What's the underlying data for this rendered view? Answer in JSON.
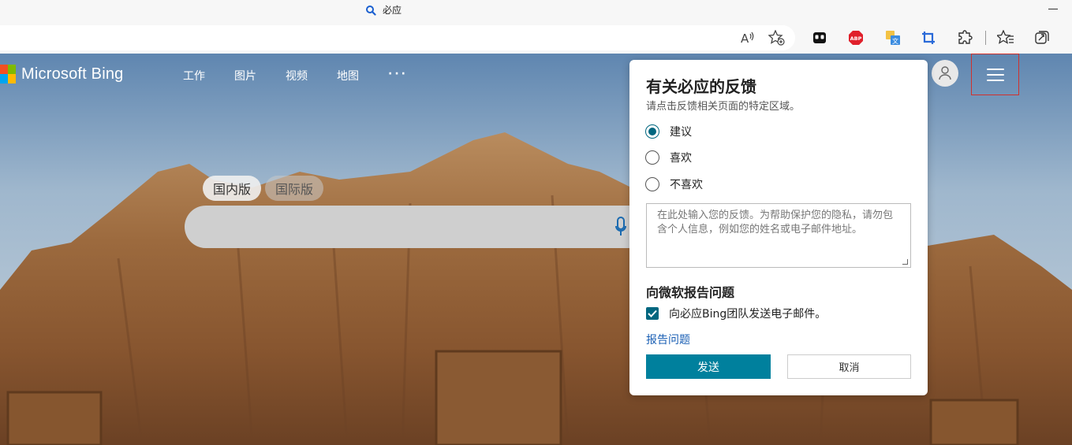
{
  "browser": {
    "tab_title": "必应",
    "toolbar_icons": [
      "read-aloud-icon",
      "add-favorite-icon",
      "extension-icon",
      "adblock-icon",
      "translate-icon",
      "crop-icon",
      "extensions-icon",
      "favorites-icon",
      "collections-icon"
    ]
  },
  "header": {
    "logo_text": "Microsoft Bing",
    "nav": [
      "工作",
      "图片",
      "视频",
      "地图"
    ],
    "more": "···"
  },
  "search": {
    "region_tabs": [
      "国内版",
      "国际版"
    ],
    "active_region": "国内版"
  },
  "feedback": {
    "title": "有关必应的反馈",
    "subtitle": "请点击反馈相关页面的特定区域。",
    "options": [
      {
        "label": "建议",
        "checked": true
      },
      {
        "label": "喜欢",
        "checked": false
      },
      {
        "label": "不喜欢",
        "checked": false
      }
    ],
    "textarea_placeholder": "在此处输入您的反馈。为帮助保护您的隐私，请勿包含个人信息，例如您的姓名或电子邮件地址。",
    "report_heading": "向微软报告问题",
    "email_checkbox_label": "向必应Bing团队发送电子邮件。",
    "email_checked": true,
    "report_link": "报告问题",
    "send_label": "发送",
    "cancel_label": "取消"
  },
  "colors": {
    "accent": "#00809d",
    "radio_accent": "#00667f",
    "highlight_border": "#d0312d"
  }
}
